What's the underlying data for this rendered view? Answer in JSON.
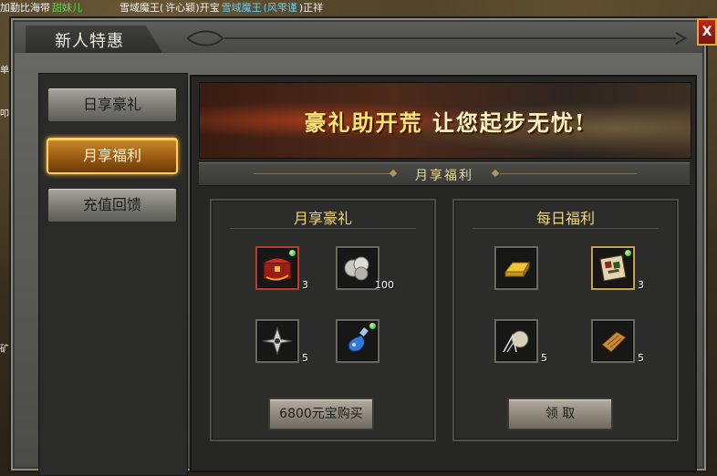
{
  "chat": {
    "left_prefix": "加勤比海带",
    "left_name": "甜妹儿",
    "middle_prefix": "雪域魔王(",
    "middle_text": "许心颖)开宝",
    "mid_name": "雪域魔王",
    "bracket_name": "(风雫谨",
    "tail": ")正祥"
  },
  "side_chars": [
    "单",
    "叩",
    "矿"
  ],
  "window": {
    "title": "新人特惠",
    "close_label": "X"
  },
  "sidebar": {
    "items": [
      {
        "label": "日享豪礼",
        "active": false
      },
      {
        "label": "月享福利",
        "active": true
      },
      {
        "label": "充值回馈",
        "active": false
      }
    ]
  },
  "banner": {
    "main": "豪礼助开荒",
    "sub": "让您起步无忧!"
  },
  "section_title": "月享福利",
  "left_panel": {
    "title": "月享豪礼",
    "items": [
      {
        "icon": "treasure-chest-icon",
        "count": "3",
        "has_dot": true
      },
      {
        "icon": "silver-coins-icon",
        "count": "100",
        "has_dot": false
      },
      {
        "icon": "shuriken-icon",
        "count": "5",
        "has_dot": false
      },
      {
        "icon": "blue-potion-icon",
        "count": "",
        "has_dot": true
      }
    ],
    "button": "6800元宝购买"
  },
  "right_panel": {
    "title": "每日福利",
    "items": [
      {
        "icon": "gold-bar-icon",
        "count": "",
        "has_dot": false
      },
      {
        "icon": "skill-book-icon",
        "count": "3",
        "has_dot": true
      },
      {
        "icon": "scroll-pouch-icon",
        "count": "5",
        "has_dot": false
      },
      {
        "icon": "ancient-scroll-icon",
        "count": "5",
        "has_dot": false
      }
    ],
    "button": "领 取"
  },
  "colors": {
    "accent_gold": "#f4d67a",
    "active_tab": "#c88a2c",
    "close_red": "#c0261c"
  }
}
